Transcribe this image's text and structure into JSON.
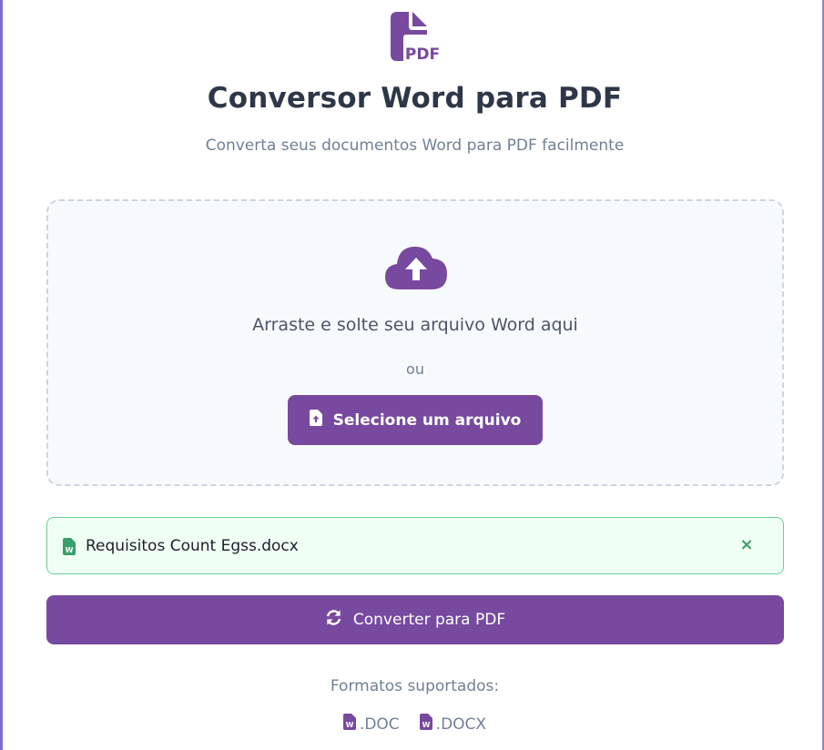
{
  "header": {
    "logo_icon": "file-pdf-icon",
    "title": "Conversor Word para PDF",
    "subtitle": "Converta seus documentos Word para PDF facilmente"
  },
  "dropzone": {
    "icon": "cloud-upload-icon",
    "drop_text": "Arraste e solte seu arquivo Word aqui",
    "or_text": "ou",
    "select_button_label": "Selecione um arquivo",
    "select_button_icon": "file-upload-icon"
  },
  "selected_file": {
    "icon": "file-word-icon",
    "name": "Requisitos Count Egss.docx",
    "remove_label": "×"
  },
  "convert": {
    "label": "Converter para PDF",
    "icon": "sync-icon"
  },
  "formats": {
    "label": "Formatos suportados:",
    "items": [
      ".DOC",
      ".DOCX"
    ]
  },
  "colors": {
    "brand": "#774a9f",
    "success_border": "#68d391",
    "success_bg": "#f0fff4",
    "success_icon": "#38a169",
    "title": "#2d3748",
    "muted": "#718096"
  }
}
